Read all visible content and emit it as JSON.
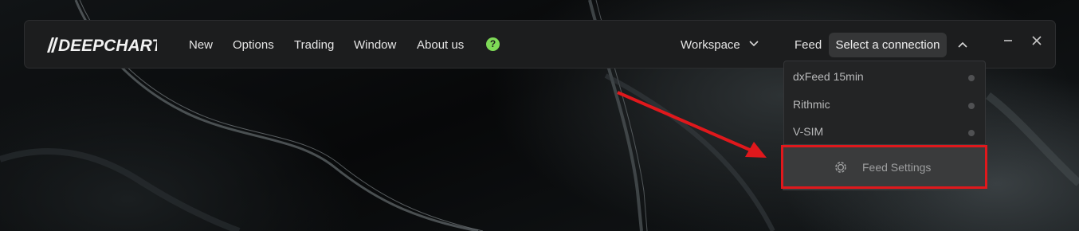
{
  "app": {
    "logo_text": "DEEPCHART"
  },
  "menu": {
    "items": [
      {
        "label": "New"
      },
      {
        "label": "Options"
      },
      {
        "label": "Trading"
      },
      {
        "label": "Window"
      },
      {
        "label": "About us"
      }
    ],
    "help_icon": "?"
  },
  "toolbar": {
    "workspace_label": "Workspace",
    "feed_label": "Feed",
    "connection_button": "Select a connection"
  },
  "dropdown": {
    "items": [
      {
        "label": "dxFeed 15min"
      },
      {
        "label": "Rithmic"
      },
      {
        "label": "V-SIM"
      }
    ],
    "settings_label": "Feed Settings"
  },
  "colors": {
    "help_icon": "#7ed957",
    "annotation": "#e0181c",
    "menubar_bg": "#1c1d1e"
  },
  "icons": [
    "help-icon",
    "chevron-down-icon",
    "chevron-up-icon",
    "minimize-icon",
    "close-icon",
    "gear-icon",
    "status-dot-icon"
  ]
}
